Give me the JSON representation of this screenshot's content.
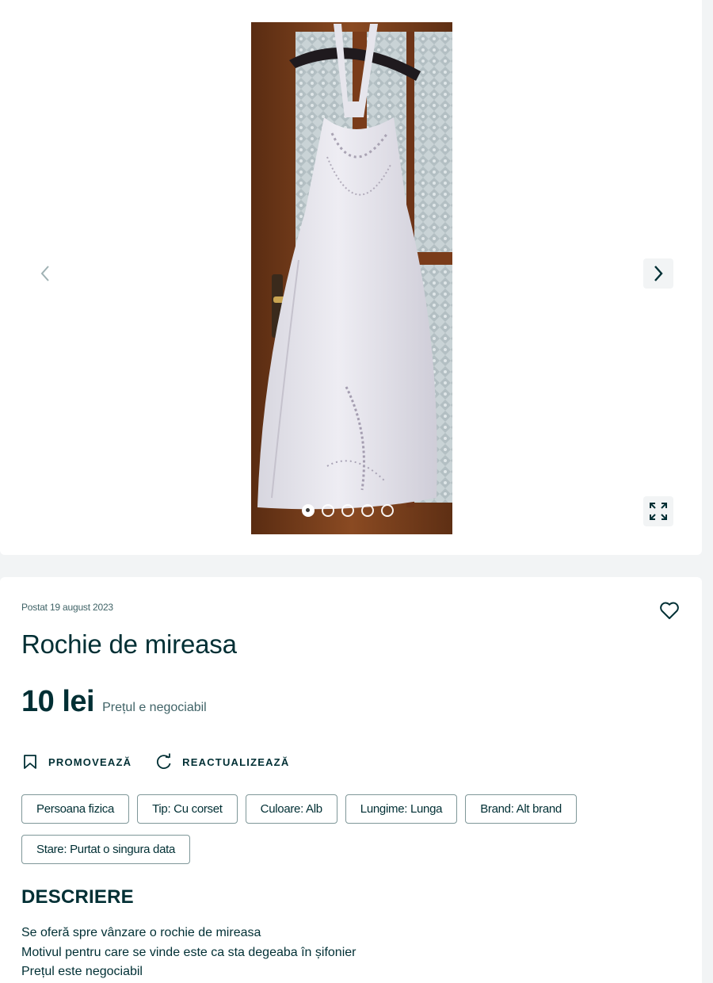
{
  "gallery": {
    "prev_label": "Previous photo",
    "next_label": "Next photo",
    "expand_label": "Expand",
    "photo_alt": "Rochie de mireasa",
    "photo_count": 5,
    "current_photo": 1
  },
  "ad": {
    "posted": "Postat 19 august 2023",
    "title": "Rochie de mireasa",
    "price": "10 lei",
    "negotiable": "Prețul e negociabil",
    "actions": {
      "promote": "PROMOVEAZĂ",
      "refresh": "REACTUALIZEAZĂ"
    },
    "tags": [
      "Persoana fizica",
      "Tip: Cu corset",
      "Culoare: Alb",
      "Lungime: Lunga",
      "Brand: Alt brand",
      "Stare: Purtat o singura data"
    ],
    "description_heading": "DESCRIERE",
    "description_lines": [
      "Se oferă spre vânzare o rochie de mireasa",
      "Motivul pentru care se vinde este ca sta degeaba în șifonier",
      "Prețul este negociabil"
    ]
  },
  "colors": {
    "text": "#002f34",
    "muted": "#406367",
    "background": "#f2f4f5",
    "card": "#ffffff"
  },
  "icons": {
    "prev": "chevron-left-icon",
    "next": "chevron-right-icon",
    "expand": "expand-icon",
    "favorite": "heart-icon",
    "promote": "bookmark-icon",
    "refresh": "refresh-icon"
  }
}
